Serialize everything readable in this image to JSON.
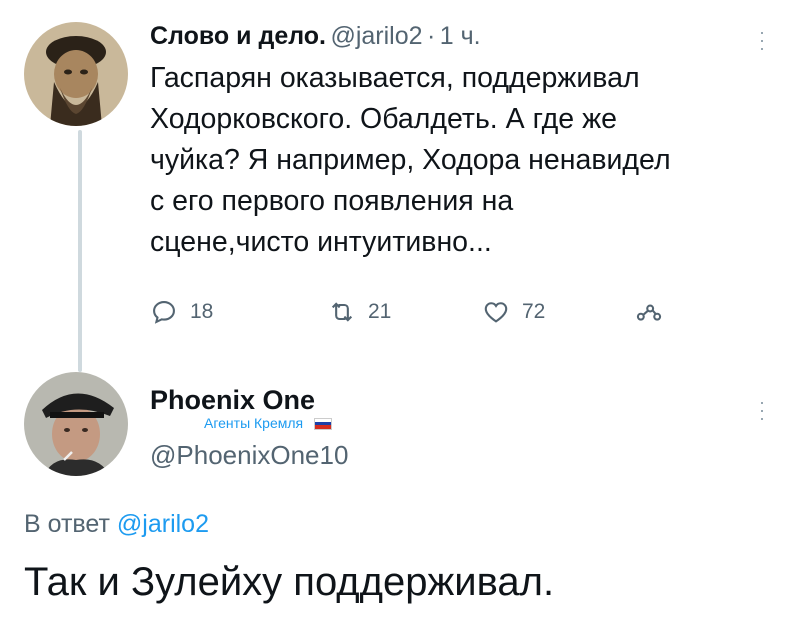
{
  "tweet1": {
    "author_name": "Слово и дело.",
    "handle": "@jarilo2",
    "separator": "·",
    "time": "1 ч.",
    "text": "Гаспарян оказывается, поддерживал\nХодорковского. Обалдеть. А где же\nчуйка? Я например, Ходора ненавидел\nс его первого появления на\nсцене,чисто интуитивно...",
    "replies": "18",
    "retweets": "21",
    "likes": "72",
    "avatar_icon": "portrait-avatar"
  },
  "tweet2": {
    "author_name": "Phoenix One",
    "sub_label": "Агенты Кремля",
    "handle": "@PhoenixOne10",
    "reply_prefix": "В ответ",
    "reply_mention": "@jarilo2",
    "text": "Так и Зулейху поддерживал.",
    "avatar_icon": "man-in-cap-avatar"
  },
  "colors": {
    "text": "#0f1419",
    "secondary": "#536471",
    "accent": "#1d9bf0",
    "thread_line": "#cfd9de"
  }
}
